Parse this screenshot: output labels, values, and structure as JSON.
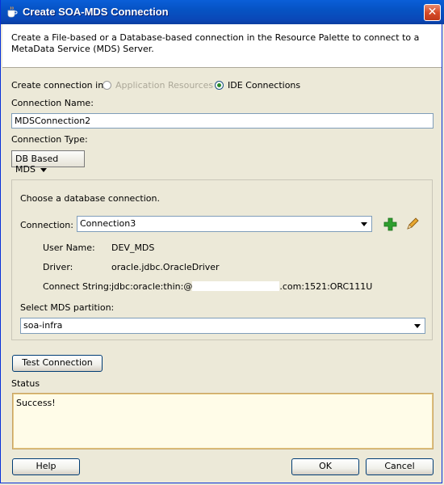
{
  "window": {
    "title": "Create SOA-MDS Connection",
    "close_glyph": "✕"
  },
  "header": {
    "description": "Create a File-based or a Database-based connection in the Resource Palette to connect to a MetaData Service (MDS) Server."
  },
  "create_in": {
    "label": "Create connection in:",
    "options": [
      {
        "label": "Application Resources",
        "selected": false,
        "enabled": false
      },
      {
        "label": "IDE Connections",
        "selected": true,
        "enabled": true
      }
    ]
  },
  "connection_name": {
    "label": "Connection Name:",
    "value": "MDSConnection2"
  },
  "connection_type": {
    "label": "Connection Type:",
    "value": "DB Based MDS"
  },
  "db_group": {
    "heading": "Choose a database connection.",
    "connection_label": "Connection:",
    "connection_value": "Connection3",
    "add_icon": "plus-icon",
    "edit_icon": "pencil-icon",
    "details": [
      {
        "label": "User Name:",
        "value": "DEV_MDS"
      },
      {
        "label": "Driver:",
        "value": "oracle.jdbc.OracleDriver"
      },
      {
        "label": "Connect String:",
        "value_prefix": "jdbc:oracle:thin:@",
        "value_suffix": ".com:1521:ORC111U"
      }
    ],
    "partition_label": "Select MDS partition:",
    "partition_value": "soa-infra"
  },
  "test_button": "Test Connection",
  "status": {
    "label": "Status",
    "text": "Success!"
  },
  "footer": {
    "help": "Help",
    "ok": "OK",
    "cancel": "Cancel"
  },
  "colors": {
    "title_bar": "#0653c4",
    "dialog_bg": "#ece9d8",
    "status_bg": "#fffce8",
    "add_icon": "#2e9e2e"
  }
}
